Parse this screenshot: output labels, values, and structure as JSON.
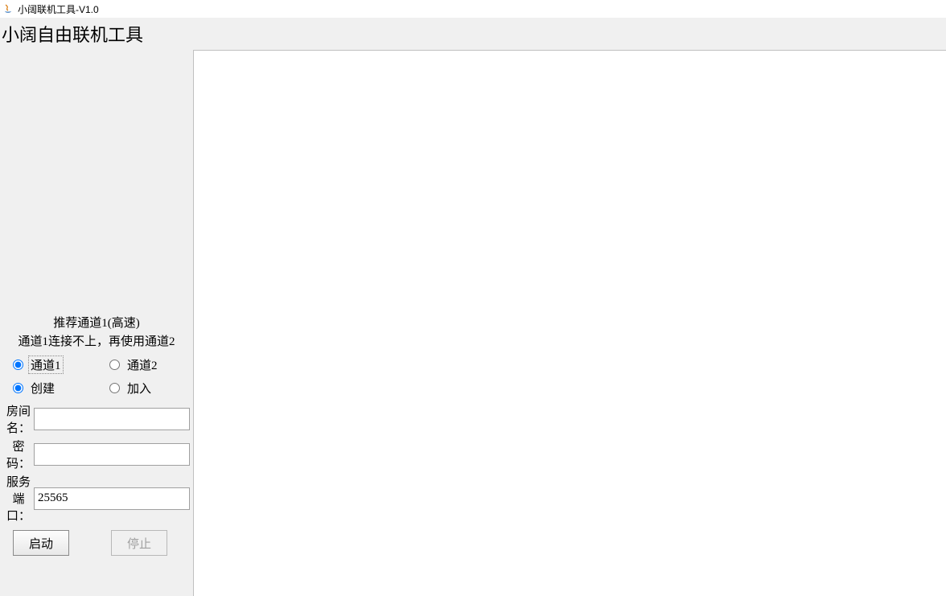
{
  "window": {
    "title": "小阔联机工具-V1.0"
  },
  "header": {
    "title": "小阔自由联机工具"
  },
  "sidebar": {
    "hint_line1": "推荐通道1(高速)",
    "hint_line2": "通道1连接不上，再使用通道2",
    "channel": {
      "option1_label": "通道1",
      "option1_selected": true,
      "option2_label": "通道2",
      "option2_selected": false
    },
    "mode": {
      "option1_label": "创建",
      "option1_selected": true,
      "option2_label": "加入",
      "option2_selected": false
    },
    "fields": {
      "room_name_label": "房间名：",
      "room_name_value": "",
      "password_label": "密码：",
      "password_value": "",
      "port_label": "服务端口：",
      "port_value": "25565"
    },
    "buttons": {
      "start_label": "启动",
      "stop_label": "停止"
    }
  }
}
